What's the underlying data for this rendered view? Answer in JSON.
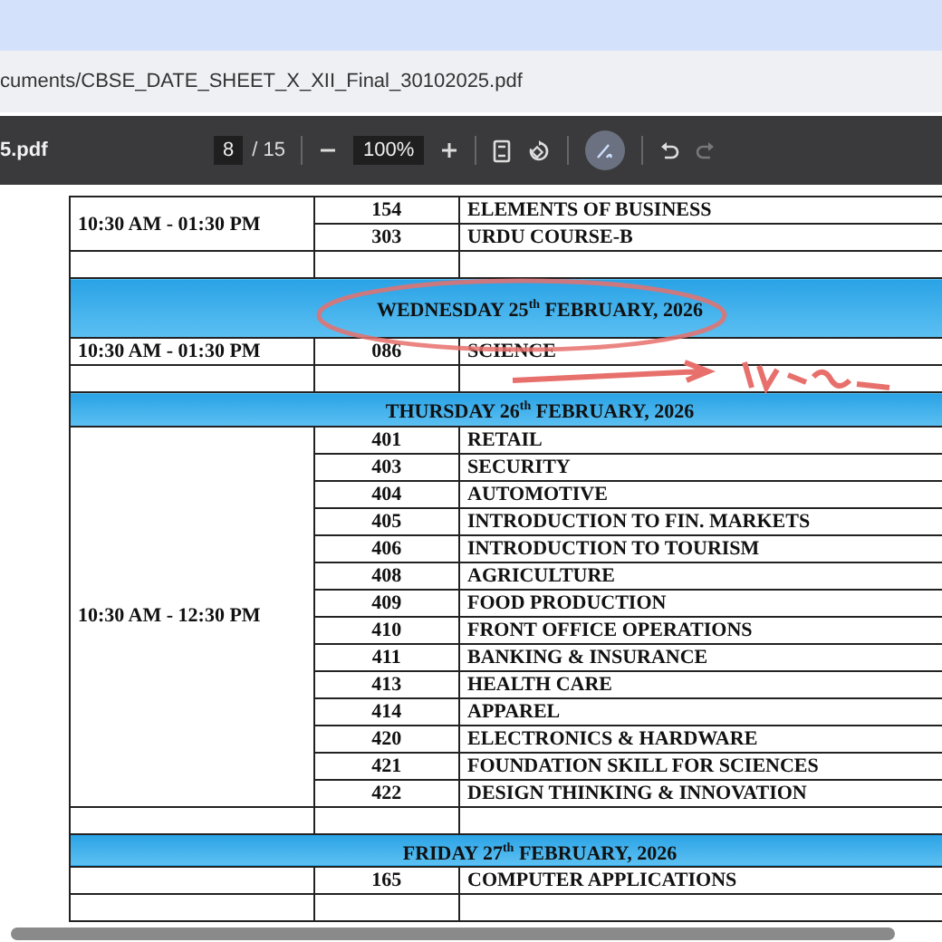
{
  "address_bar": {
    "url": "cuments/CBSE_DATE_SHEET_X_XII_Final_30102025.pdf"
  },
  "toolbar": {
    "file_name": "5.pdf",
    "page": "8",
    "page_count": "/ 15",
    "zoom": "100%",
    "draw_selected": true,
    "redo_disabled": true
  },
  "schedule": {
    "blocks": [
      {
        "time": "10:30 AM - 01:30 PM",
        "rows": [
          {
            "code": "154",
            "subject": "ELEMENTS OF BUSINESS"
          },
          {
            "code": "303",
            "subject": "URDU COURSE-B"
          }
        ]
      },
      {
        "date": "WEDNESDAY 25$^{th}$ FEBRUARY, 2026",
        "time": "10:30 AM - 01:30 PM",
        "rows": [
          {
            "code": "086",
            "subject": "SCIENCE"
          }
        ]
      },
      {
        "date": "THURSDAY 26$^{th}$ FEBRUARY, 2026",
        "time": "10:30 AM - 12:30 PM",
        "rows": [
          {
            "code": "401",
            "subject": "RETAIL"
          },
          {
            "code": "403",
            "subject": "SECURITY"
          },
          {
            "code": "404",
            "subject": "AUTOMOTIVE"
          },
          {
            "code": "405",
            "subject": "INTRODUCTION TO FIN. MARKETS"
          },
          {
            "code": "406",
            "subject": "INTRODUCTION TO TOURISM"
          },
          {
            "code": "408",
            "subject": "AGRICULTURE"
          },
          {
            "code": "409",
            "subject": "FOOD PRODUCTION"
          },
          {
            "code": "410",
            "subject": "FRONT OFFICE OPERATIONS"
          },
          {
            "code": "411",
            "subject": "BANKING & INSURANCE"
          },
          {
            "code": "413",
            "subject": "HEALTH CARE"
          },
          {
            "code": "414",
            "subject": "APPAREL"
          },
          {
            "code": "420",
            "subject": "ELECTRONICS & HARDWARE"
          },
          {
            "code": "421",
            "subject": "FOUNDATION SKILL FOR SCIENCES"
          },
          {
            "code": "422",
            "subject": "DESIGN THINKING & INNOVATION"
          }
        ]
      },
      {
        "date": "FRIDAY 27$^{th}$ FEBRUARY, 2026",
        "rows": [
          {
            "code": "165",
            "subject": "COMPUTER APPLICATIONS"
          }
        ]
      }
    ]
  }
}
